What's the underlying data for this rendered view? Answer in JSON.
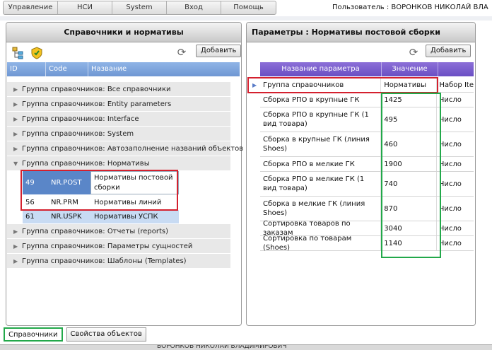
{
  "menu": [
    "Управление",
    "НСИ",
    "System",
    "Вход",
    "Помощь"
  ],
  "user": "Пользователь : ВОРОНКОВ НИКОЛАЙ ВЛА",
  "left_panel": {
    "title": "Справочники и нормативы",
    "add_label": "Добавить",
    "columns": [
      "ID",
      "Code",
      "Название"
    ],
    "groups_top": [
      "Группа справочников:  Все справочники",
      "Группа справочников: Entity parameters",
      "Группа справочников: Interface",
      "Группа справочников: System",
      "Группа справочников: Автозаполнение названий объектов",
      "Группа справочников: Нормативы"
    ],
    "rows": [
      {
        "id": "49",
        "code": "NR.POST",
        "name": "Нормативы постовой сборки"
      },
      {
        "id": "56",
        "code": "NR.PRM",
        "name": "Нормативы линий УОС"
      },
      {
        "id": "61",
        "code": "NR.USPK",
        "name": "Нормативы УСПК"
      }
    ],
    "groups_bottom": [
      "Группа справочников: Отчеты (reports)",
      "Группа справочников: Параметры сущностей",
      "Группа справочников: Шаблоны (Templates)"
    ]
  },
  "right_panel": {
    "title": "Параметры : Нормативы постовой сборки",
    "add_label": "Добавить",
    "columns": [
      "Название параметра",
      "Значение"
    ],
    "rows": [
      {
        "param": "Группа справочников",
        "value": "Нормативы",
        "type": "Набор Ite"
      },
      {
        "param": "Сборка РПО в крупные ГК",
        "value": "1425",
        "type": "Число"
      },
      {
        "param": "Сборка РПО в крупные ГК (1 вид товара)",
        "value": "495",
        "type": "Число"
      },
      {
        "param": "Сборка в крупные ГК (линия Shoes)",
        "value": "460",
        "type": "Число"
      },
      {
        "param": "Сборка РПО в мелкие ГК",
        "value": "1900",
        "type": "Число"
      },
      {
        "param": "Сборка РПО в мелкие ГК (1 вид товара)",
        "value": "740",
        "type": "Число"
      },
      {
        "param": "Сборка в мелкие ГК (линия Shoes)",
        "value": "870",
        "type": "Число"
      },
      {
        "param": "Сортировка товаров по заказам",
        "value": "3040",
        "type": "Число"
      },
      {
        "param": "Сортировка по товарам (Shoes)",
        "value": "1140",
        "type": "Число"
      }
    ]
  },
  "tabs": [
    "Справочники",
    "Свойства объектов"
  ],
  "status": "ВОРОНКОВ НИКОЛАЙ ВЛАДИМИРОВИЧ"
}
